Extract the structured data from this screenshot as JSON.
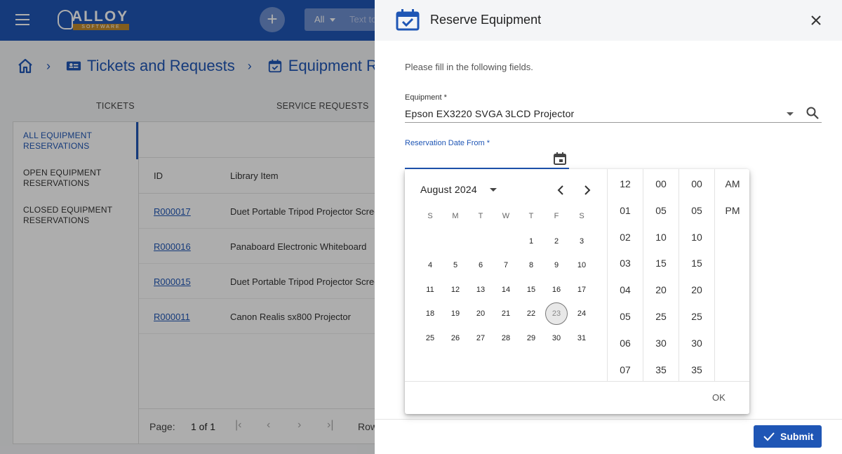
{
  "app": {
    "logo_text": "ALLOY",
    "logo_sub": "SOFTWARE",
    "search_scope": "All",
    "search_placeholder": "Text to"
  },
  "breadcrumb": {
    "section": "Tickets and Requests",
    "page": "Equipment R"
  },
  "tabs": [
    "TICKETS",
    "SERVICE REQUESTS"
  ],
  "sidebar": {
    "items": [
      {
        "label": "ALL EQUIPMENT RESERVATIONS",
        "active": true
      },
      {
        "label": "OPEN EQUIPMENT RESERVATIONS",
        "active": false
      },
      {
        "label": "CLOSED EQUIPMENT RESERVATIONS",
        "active": false
      }
    ]
  },
  "grid": {
    "columns": [
      "ID",
      "Library Item"
    ],
    "rows": [
      {
        "id": "R000017",
        "item": "Duet Portable Tripod Projector Scree"
      },
      {
        "id": "R000016",
        "item": "Panaboard Electronic Whiteboard"
      },
      {
        "id": "R000015",
        "item": "Duet Portable Tripod Projector Scree"
      },
      {
        "id": "R000011",
        "item": "Canon Realis sx800 Projector"
      }
    ],
    "pager": {
      "label": "Page:",
      "value": "1 of 1",
      "rows_label": "Row"
    }
  },
  "drawer": {
    "title": "Reserve Equipment",
    "intro": "Please fill in the following fields.",
    "equipment_label": "Equipment *",
    "equipment_value": "Epson EX3220 SVGA 3LCD Projector",
    "date_from_label": "Reservation Date From *",
    "submit_label": "Submit"
  },
  "picker": {
    "month_label": "August 2024",
    "weekdays": [
      "S",
      "M",
      "T",
      "W",
      "T",
      "F",
      "S"
    ],
    "first_weekday": 4,
    "days_in_month": 31,
    "today": 23,
    "hours": [
      "12",
      "01",
      "02",
      "03",
      "04",
      "05",
      "06",
      "07"
    ],
    "minutes": [
      "00",
      "05",
      "10",
      "15",
      "20",
      "25",
      "30",
      "35"
    ],
    "seconds": [
      "00",
      "05",
      "10",
      "15",
      "20",
      "25",
      "30",
      "35"
    ],
    "meridiem": [
      "AM",
      "PM"
    ],
    "ok_label": "OK"
  },
  "colors": {
    "brand": "#1f56b5",
    "overlay": "rgba(0,0,0,0.32)"
  }
}
